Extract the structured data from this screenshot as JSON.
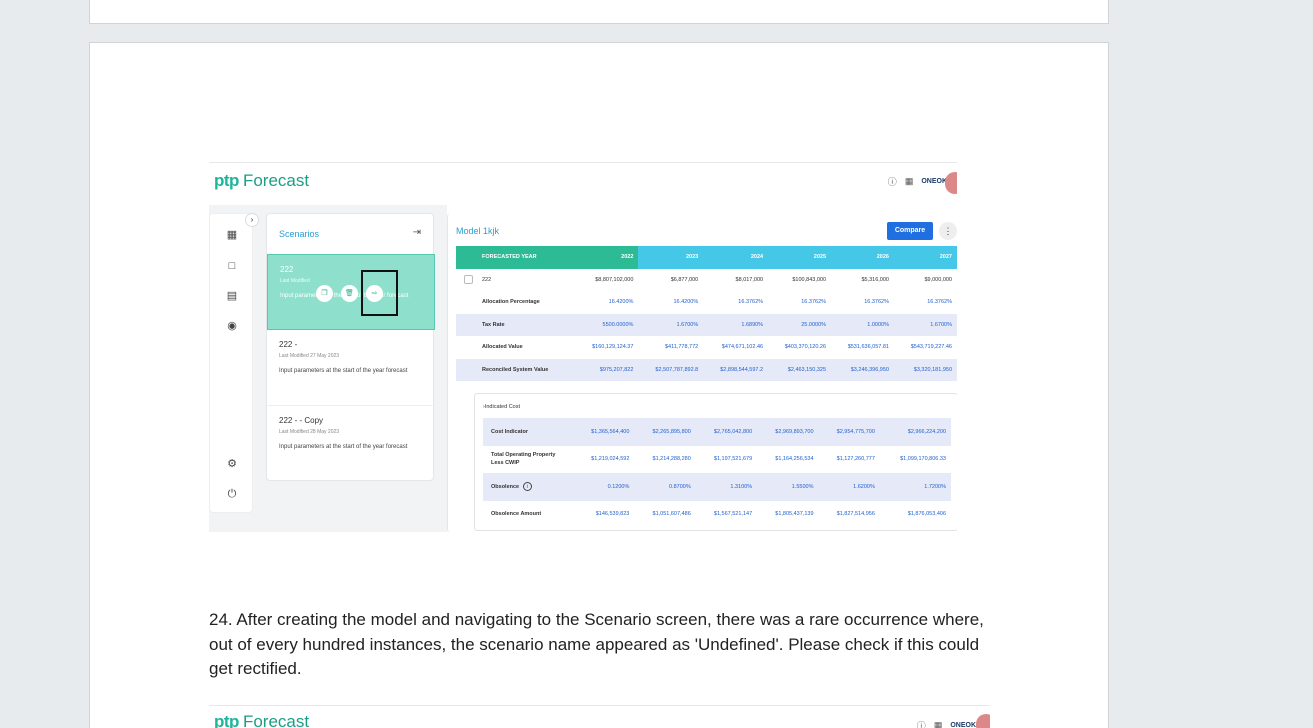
{
  "app": {
    "logo_ptp": "ptp",
    "logo_forecast": "Forecast",
    "brand": "ONEOK"
  },
  "scenarios": {
    "title": "Scenarios",
    "items": [
      {
        "name": "222",
        "modified": "Last Modified",
        "description": "Input parameters at the start of the year forecast"
      },
      {
        "name": "222 -",
        "modified": "Last Modified 27 May 2023",
        "description": "Input parameters at the start of the year forecast"
      },
      {
        "name": "222 - - Copy",
        "modified": "Last Modified 28 May 2023",
        "description": "Input parameters at the start of the year forecast"
      }
    ]
  },
  "model": {
    "title": "Model 1kjk",
    "compare_label": "Compare",
    "table": {
      "header": [
        "FORECASTED YEAR",
        "2022",
        "2023",
        "2024",
        "2025",
        "2026",
        "2027"
      ],
      "rows": [
        {
          "label": "222",
          "values": [
            "$8,807,102,000",
            "$6,877,000",
            "$8,017,000",
            "$100,843,000",
            "$5,316,000",
            "$9,000,000"
          ]
        },
        {
          "label": "Allocation Percentage",
          "values": [
            "16.4200%",
            "16.4200%",
            "16.3762%",
            "16.3762%",
            "16.3762%",
            "16.3762%"
          ]
        },
        {
          "label": "Tax Rate",
          "values": [
            "5500.0000%",
            "1.6700%",
            "1.6890%",
            "25.0000%",
            "1.0000%",
            "1.6700%"
          ]
        },
        {
          "label": "Allocated Value",
          "values": [
            "$160,129,124.37",
            "$411,778,772",
            "$474,671,102.46",
            "$403,370,120.26",
            "$531,636,057.81",
            "$543,719,227.46"
          ]
        },
        {
          "label": "Reconciled System Value",
          "values": [
            "$975,207,822",
            "$2,507,787,892.8",
            "$2,898,544,597.2",
            "$2,463,150,325",
            "$3,246,396,950",
            "$3,320,181,950"
          ]
        }
      ]
    },
    "indicated": {
      "title": "Indicated Cost",
      "rows": [
        {
          "label": "Cost Indicator",
          "values": [
            "$1,365,564,400",
            "$2,265,895,800",
            "$2,765,042,800",
            "$2,969,893,700",
            "$2,954,775,700",
            "$2,966,224,200"
          ]
        },
        {
          "label": "Total Operating Property Less CWIP",
          "values": [
            "$1,219,024,592",
            "$1,214,288,280",
            "$1,197,521,679",
            "$1,164,256,534",
            "$1,127,260,777",
            "$1,099,170,806.33"
          ]
        },
        {
          "label": "Obsolence",
          "values": [
            "0.1200%",
            "0.8700%",
            "1.3100%",
            "1.5500%",
            "1.6200%",
            "1.7200%"
          ]
        },
        {
          "label": "Obsolence Amount",
          "values": [
            "$146,539,823",
            "$1,051,607,486",
            "$1,567,521,147",
            "$1,805,437,139",
            "$1,827,514,956",
            "$1,876,053,406"
          ]
        }
      ]
    }
  },
  "instruction_text": "24. After creating the model and navigating to the Scenario screen, there was a rare occurrence where, out of every hundred instances, the scenario name appeared as 'Undefined'. Please check if this could get rectified."
}
